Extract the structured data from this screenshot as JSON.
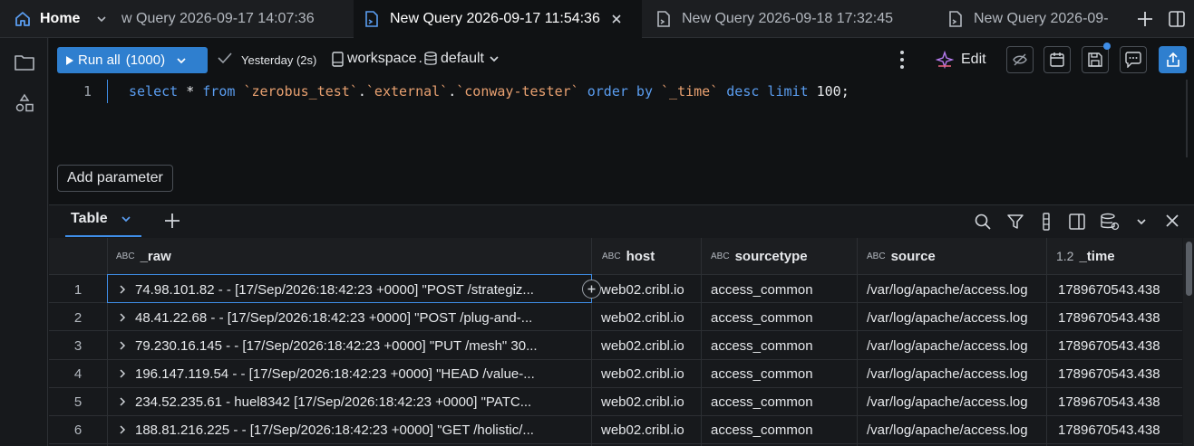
{
  "tabs": {
    "home": "Home",
    "tab1": "w Query 2026-09-17 14:07:36",
    "tab2": "New Query 2026-09-17 11:54:36",
    "tab3": "New Query 2026-09-18 17:32:45",
    "tab4": "New Query 2026-09-"
  },
  "toolbar": {
    "run_label": "Run all",
    "run_limit": "(1000)",
    "last_run": "Yesterday (2s)",
    "catalog": "workspace",
    "catalog_sep": ".",
    "schema": "default",
    "edit_label": "Edit"
  },
  "editor": {
    "line_number": "1",
    "tokens": {
      "t1": "select",
      "t2": " * ",
      "t3": "from",
      "t4": " ",
      "t5": "`zerobus_test`",
      "t6": ".",
      "t7": "`external`",
      "t8": ".",
      "t9": "`conway-tester`",
      "t10": " ",
      "t11": "order by",
      "t12": " ",
      "t13": "`_time`",
      "t14": " ",
      "t15": "desc limit",
      "t16": " 100;"
    },
    "add_parameter": "Add parameter"
  },
  "results": {
    "view_tab": "Table",
    "columns": [
      {
        "type": "ABC",
        "name": "_raw"
      },
      {
        "type": "ABC",
        "name": "host"
      },
      {
        "type": "ABC",
        "name": "sourcetype"
      },
      {
        "type": "ABC",
        "name": "source"
      },
      {
        "type": "1.2",
        "name": "_time"
      }
    ],
    "rows": [
      {
        "n": "1",
        "raw": "74.98.101.82 - - [17/Sep/2026:18:42:23 +0000] \"POST /strategiz...",
        "host": "web02.cribl.io",
        "sourcetype": "access_common",
        "source": "/var/log/apache/access.log",
        "time": "1789670543.438"
      },
      {
        "n": "2",
        "raw": "48.41.22.68 - - [17/Sep/2026:18:42:23 +0000] \"POST /plug-and-...",
        "host": "web02.cribl.io",
        "sourcetype": "access_common",
        "source": "/var/log/apache/access.log",
        "time": "1789670543.438"
      },
      {
        "n": "3",
        "raw": "79.230.16.145 - - [17/Sep/2026:18:42:23 +0000] \"PUT /mesh\" 30...",
        "host": "web02.cribl.io",
        "sourcetype": "access_common",
        "source": "/var/log/apache/access.log",
        "time": "1789670543.438"
      },
      {
        "n": "4",
        "raw": "196.147.119.54 - - [17/Sep/2026:18:42:23 +0000] \"HEAD /value-...",
        "host": "web02.cribl.io",
        "sourcetype": "access_common",
        "source": "/var/log/apache/access.log",
        "time": "1789670543.438"
      },
      {
        "n": "5",
        "raw": "234.52.235.61 - huel8342 [17/Sep/2026:18:42:23 +0000] \"PATC...",
        "host": "web02.cribl.io",
        "sourcetype": "access_common",
        "source": "/var/log/apache/access.log",
        "time": "1789670543.438"
      },
      {
        "n": "6",
        "raw": "188.81.216.225 - - [17/Sep/2026:18:42:23 +0000] \"GET /holistic/...",
        "host": "web02.cribl.io",
        "sourcetype": "access_common",
        "source": "/var/log/apache/access.log",
        "time": "1789670543.438"
      }
    ]
  },
  "colors": {
    "accent": "#2f7fcf",
    "background": "#101214",
    "keyword": "#5a9df0",
    "string": "#e8a070"
  }
}
